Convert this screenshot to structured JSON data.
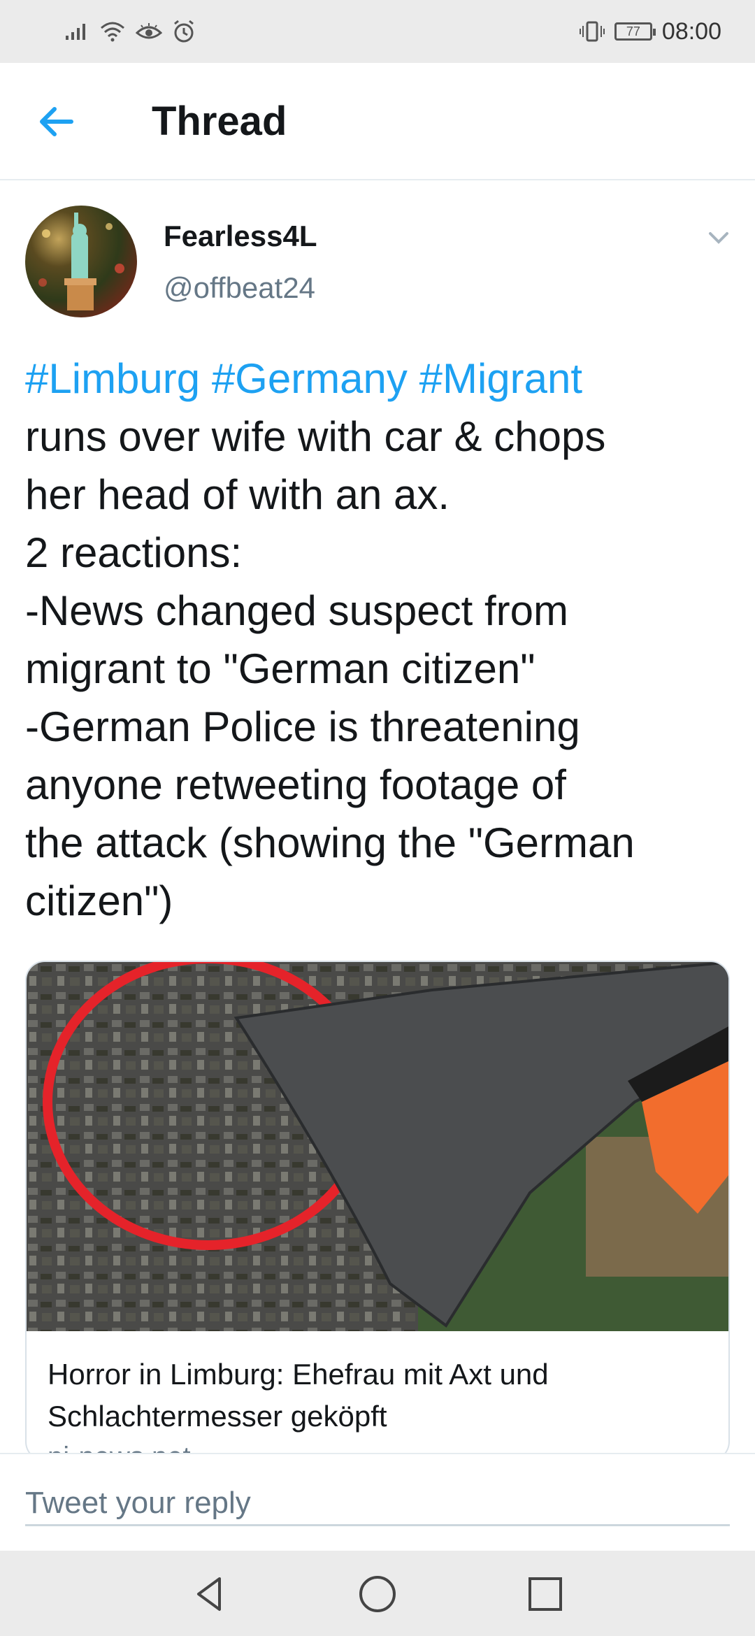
{
  "status_bar": {
    "time": "08:00",
    "battery_level": "77",
    "icons": [
      "signal-icon",
      "wifi-icon",
      "eye-icon",
      "alarm-icon",
      "vibrate-icon",
      "battery-icon"
    ]
  },
  "header": {
    "title": "Thread",
    "back_icon": "arrow-left-icon"
  },
  "tweet": {
    "author_name": "Fearless4L",
    "author_handle": "@offbeat24",
    "hashtags": [
      "#Limburg",
      "#Germany",
      "#Migrant"
    ],
    "body": "runs over wife with car & chops\nher head of with an ax.\n2 reactions:\n-News changed suspect from\nmigrant to \"German citizen\"\n-German Police is threatening\nanyone retweeting footage of\nthe attack (showing the \"German\ncitizen\")",
    "link_card": {
      "title": "Horror in Limburg: Ehefrau mit Axt und Schlachtermesser geköpft",
      "domain": "pi-news.net"
    }
  },
  "reply": {
    "placeholder": "Tweet your reply"
  },
  "colors": {
    "accent": "#1da1f2",
    "text_primary": "#14171a",
    "text_secondary": "#657786"
  }
}
